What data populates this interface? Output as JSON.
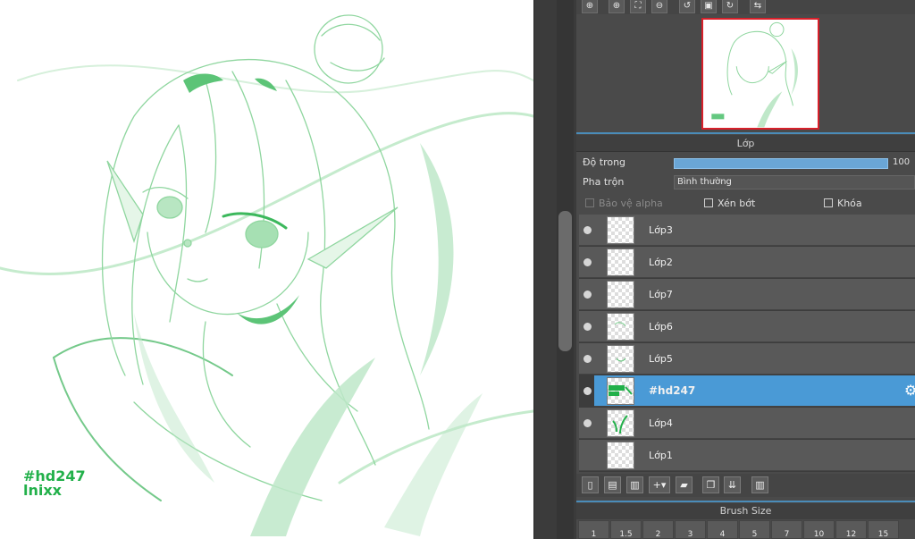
{
  "canvas": {
    "watermark_line1": "#hd247",
    "watermark_line2": "lnixx"
  },
  "navigator_toolbar": {
    "buttons": [
      "zoom-in-icon",
      "zoom-in-icon",
      "fit-icon",
      "zoom-out-icon",
      "rotate-left-icon",
      "reset-icon",
      "rotate-right-icon",
      "flip-icon"
    ]
  },
  "layer_panel": {
    "title": "Lớp",
    "opacity_label": "Độ trong",
    "opacity_value": "100 %",
    "opacity_fraction": 1.0,
    "blend_label": "Pha trộn",
    "blend_value": "Bình thường",
    "protect_alpha_label": "Bảo vệ alpha",
    "clipping_label": "Xén bớt",
    "lock_label": "Khóa",
    "layers": [
      {
        "name": "Lớp3",
        "visible": true,
        "active": false
      },
      {
        "name": "Lớp2",
        "visible": true,
        "active": false
      },
      {
        "name": "Lớp7",
        "visible": true,
        "active": false
      },
      {
        "name": "Lớp6",
        "visible": true,
        "active": false
      },
      {
        "name": "Lớp5",
        "visible": true,
        "active": false
      },
      {
        "name": "#hd247",
        "visible": true,
        "active": true
      },
      {
        "name": "Lớp4",
        "visible": true,
        "active": false
      },
      {
        "name": "Lớp1",
        "visible": false,
        "active": false
      }
    ]
  },
  "brush_panel": {
    "title": "Brush Size",
    "sizes": [
      "1",
      "1.5",
      "2",
      "3",
      "4",
      "5",
      "7",
      "10",
      "12",
      "15"
    ]
  },
  "colors": {
    "accent": "#4a9ad6",
    "sketch_green": "#22b04a"
  }
}
